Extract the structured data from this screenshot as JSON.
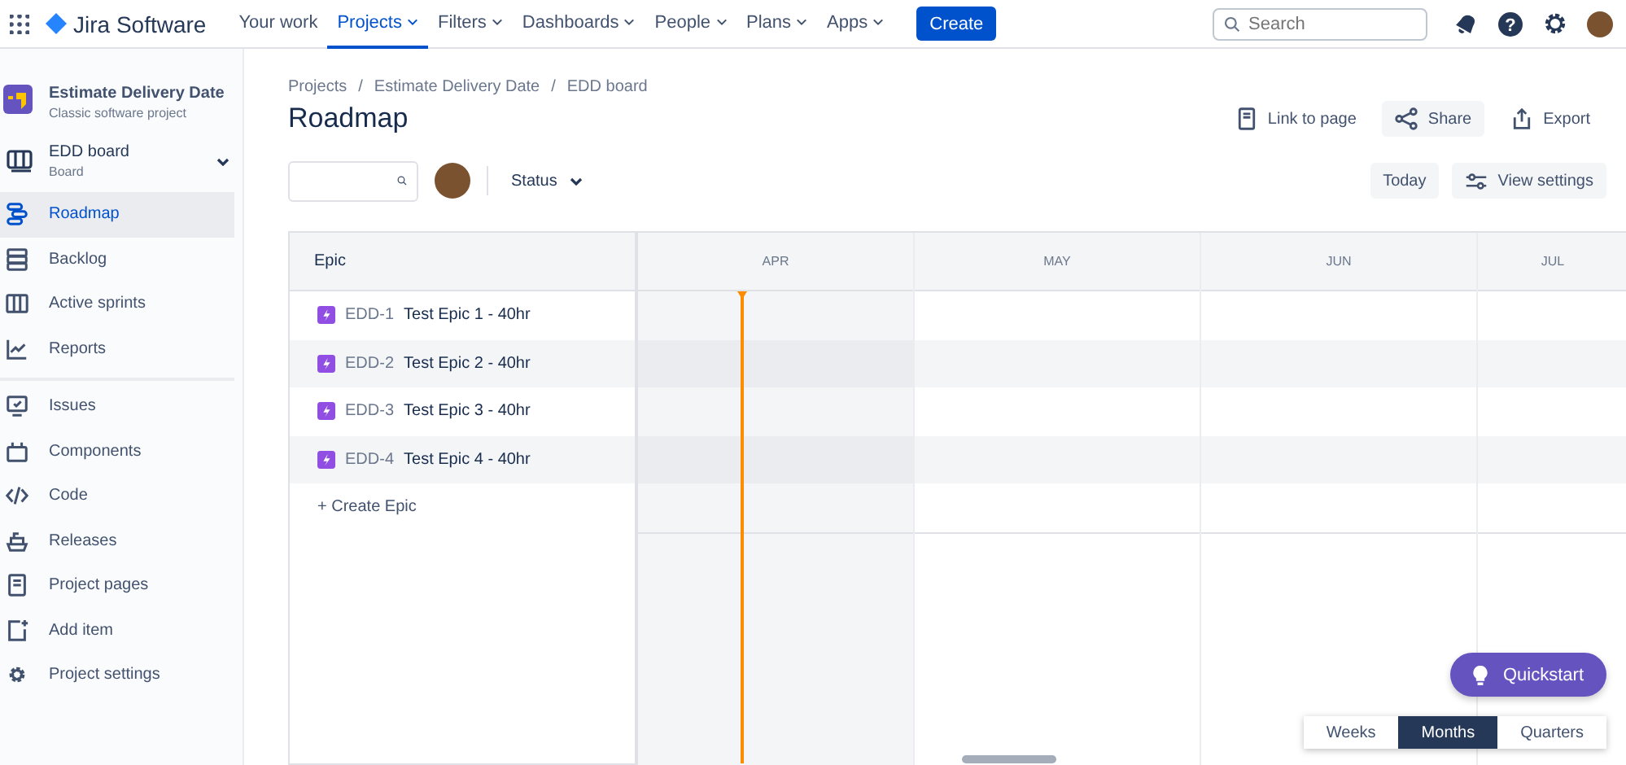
{
  "top_nav": {
    "product": "Jira Software",
    "items": [
      {
        "label": "Your work",
        "dropdown": false,
        "selected": false
      },
      {
        "label": "Projects",
        "dropdown": true,
        "selected": true
      },
      {
        "label": "Filters",
        "dropdown": true,
        "selected": false
      },
      {
        "label": "Dashboards",
        "dropdown": true,
        "selected": false
      },
      {
        "label": "People",
        "dropdown": true,
        "selected": false
      },
      {
        "label": "Plans",
        "dropdown": true,
        "selected": false
      },
      {
        "label": "Apps",
        "dropdown": true,
        "selected": false
      }
    ],
    "create_button": "Create",
    "search": {
      "placeholder": "Search"
    },
    "help_icon": "?"
  },
  "sidebar": {
    "project": {
      "name": "Estimate Delivery Date",
      "type": "Classic software project"
    },
    "board": {
      "name": "EDD board",
      "type": "Board"
    },
    "items": [
      {
        "label": "Roadmap",
        "selected": true
      },
      {
        "label": "Backlog",
        "selected": false
      },
      {
        "label": "Active sprints",
        "selected": false
      },
      {
        "label": "Reports",
        "selected": false
      },
      {
        "label": "Issues",
        "selected": false
      },
      {
        "label": "Components",
        "selected": false
      },
      {
        "label": "Code",
        "selected": false
      },
      {
        "label": "Releases",
        "selected": false
      },
      {
        "label": "Project pages",
        "selected": false
      },
      {
        "label": "Add item",
        "selected": false
      },
      {
        "label": "Project settings",
        "selected": false
      }
    ]
  },
  "breadcrumbs": {
    "separator": "/",
    "items": [
      "Projects",
      "Estimate Delivery Date",
      "EDD board"
    ]
  },
  "page_title": "Roadmap",
  "header_actions": [
    {
      "label": "Link to page"
    },
    {
      "label": "Share"
    },
    {
      "label": "Export"
    }
  ],
  "toolbar": {
    "status_filter": "Status",
    "today_button": "Today",
    "view_settings": "View settings"
  },
  "roadmap": {
    "epic_column": "Epic",
    "months": [
      "APR",
      "MAY",
      "JUN",
      "JUL"
    ],
    "epics": [
      {
        "key": "EDD-1",
        "summary": "Test Epic 1 - 40hr"
      },
      {
        "key": "EDD-2",
        "summary": "Test Epic 2 - 40hr"
      },
      {
        "key": "EDD-3",
        "summary": "Test Epic 3 - 40hr"
      },
      {
        "key": "EDD-4",
        "summary": "Test Epic 4 - 40hr"
      }
    ],
    "create_epic": "+ Create Epic"
  },
  "quickstart": "Quickstart",
  "timescale": [
    {
      "label": "Weeks",
      "selected": false
    },
    {
      "label": "Months",
      "selected": true
    },
    {
      "label": "Quarters",
      "selected": false
    }
  ]
}
